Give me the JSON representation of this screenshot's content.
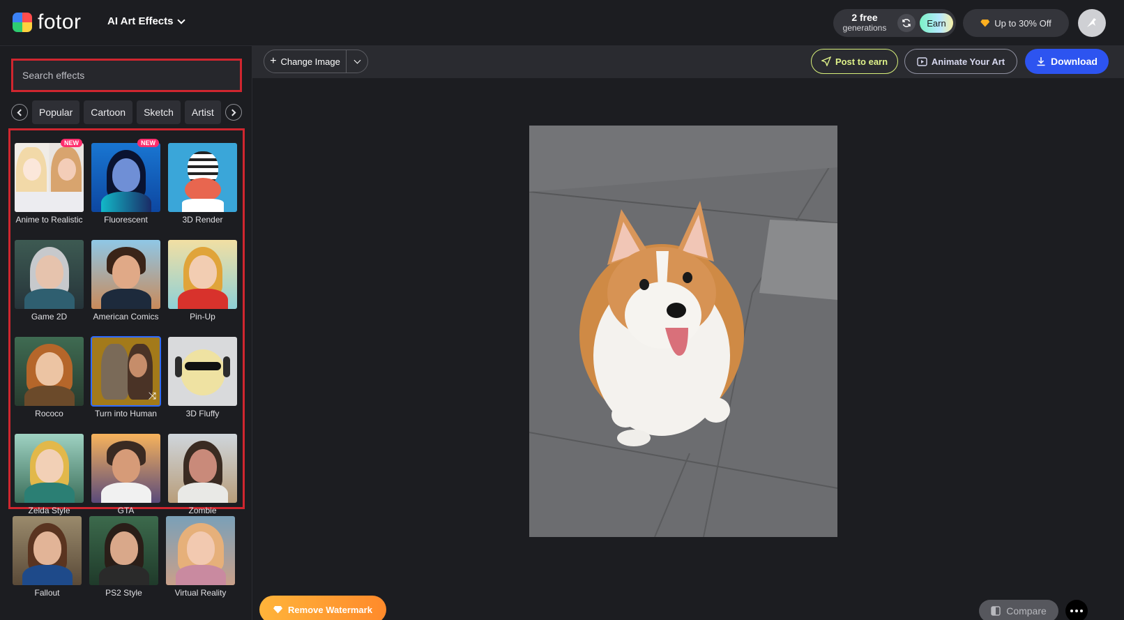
{
  "header": {
    "logo_text": "fotor",
    "menu_label": "AI Art Effects",
    "generations_count": "2 free",
    "generations_label": "generations",
    "earn_label": "Earn",
    "promo_label": "Up to 30% Off"
  },
  "sidebar": {
    "search_placeholder": "Search effects",
    "categories": [
      "Popular",
      "Cartoon",
      "Sketch",
      "Artist"
    ],
    "badge_new": "NEW",
    "effects": [
      {
        "label": "Anime to Realistic",
        "badge": "NEW"
      },
      {
        "label": "Fluorescent",
        "badge": "NEW"
      },
      {
        "label": "3D Render"
      },
      {
        "label": "Game 2D"
      },
      {
        "label": "American Comics"
      },
      {
        "label": "Pin-Up"
      },
      {
        "label": "Rococo"
      },
      {
        "label": "Turn into Human",
        "selected": true
      },
      {
        "label": "3D Fluffy"
      },
      {
        "label": "Zelda Style"
      },
      {
        "label": "GTA"
      },
      {
        "label": "Zombie"
      }
    ],
    "more_effects": [
      {
        "label": "Fallout"
      },
      {
        "label": "PS2 Style"
      },
      {
        "label": "Virtual Reality"
      }
    ]
  },
  "toolbar": {
    "change_image_label": "Change Image",
    "post_label": "Post to earn",
    "animate_label": "Animate Your Art",
    "download_label": "Download"
  },
  "canvas": {
    "remove_watermark_label": "Remove Watermark",
    "compare_label": "Compare"
  },
  "colors": {
    "accent_blue": "#2d54f0",
    "highlight_red": "#d0262f",
    "post_yellow": "#d8f07a",
    "watermark_orange": "#ff8a2b"
  }
}
